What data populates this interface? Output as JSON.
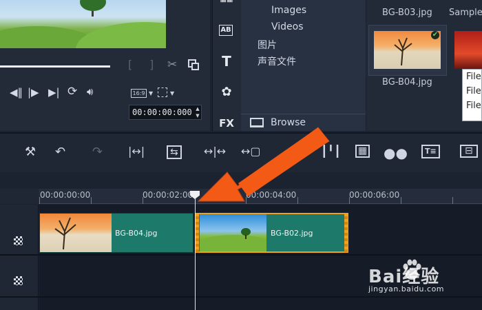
{
  "player": {
    "bracket_in": "[",
    "bracket_out": "]",
    "aspect_ratio": "16:9",
    "timecode": "00:00:00:000",
    "controls": [
      "previous-frame",
      "play",
      "next-frame",
      "repeat",
      "volume"
    ]
  },
  "library": {
    "items": [
      "Images",
      "Videos",
      "图片",
      "声音文件"
    ],
    "browse_label": "Browse",
    "sidebar_icons": [
      "transition",
      "title-ab",
      "text-T",
      "graphics",
      "FX"
    ]
  },
  "media": {
    "items": [
      {
        "label": "BG-B03.jpg"
      },
      {
        "label": "Sample"
      },
      {
        "label": "BG-B04.jpg"
      }
    ],
    "tooltip_lines": [
      "File",
      "File",
      "File"
    ]
  },
  "timeline": {
    "ruler_labels": [
      "00:00:00:00",
      "00:00:02:00",
      "00:00:04:00",
      "00:00:06:00"
    ],
    "clips": [
      {
        "label": "BG-B04.jpg"
      },
      {
        "label": "BG-B02.jpg"
      }
    ]
  },
  "watermark": {
    "brand": "Bai经验",
    "url": "jingyan.baidu.com"
  },
  "colors": {
    "accent_orange": "#f25a16",
    "clip_green": "#1d7a6b",
    "clip_selected_border": "#f0a11f"
  }
}
